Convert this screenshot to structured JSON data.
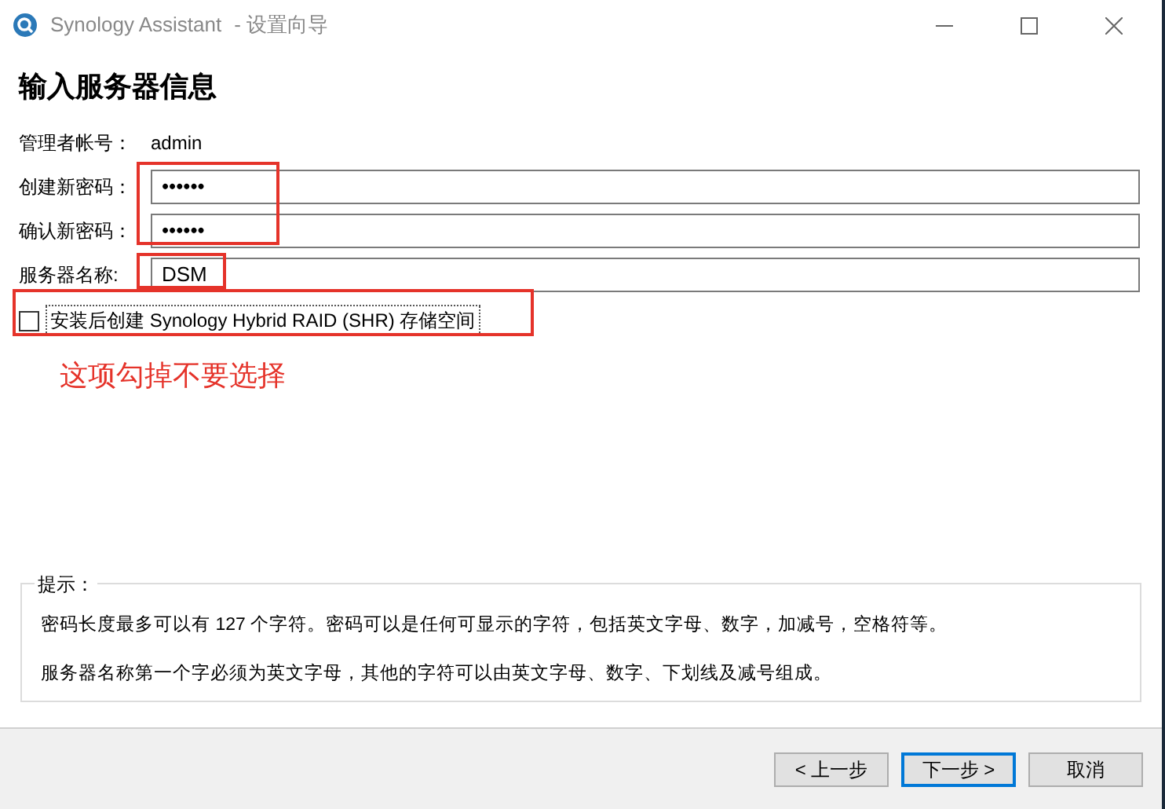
{
  "window": {
    "title": "Synology Assistant",
    "subtitle": "- 设置向导"
  },
  "heading": "输入服务器信息",
  "form": [
    {
      "kind": "static",
      "label": "管理者帐号：",
      "value": "admin"
    },
    {
      "kind": "input",
      "label": "创建新密码：",
      "value": "••••••"
    },
    {
      "kind": "input",
      "label": "确认新密码：",
      "value": "••••••"
    },
    {
      "kind": "input",
      "label": "服务器名称:",
      "value": "DSM"
    }
  ],
  "checkbox": {
    "label": "安装后创建 Synology Hybrid RAID (SHR) 存储空间",
    "checked": false
  },
  "annotation": "这项勾掉不要选择",
  "hints": {
    "title": "提示：",
    "lines": [
      "密码长度最多可以有 127 个字符。密码可以是任何可显示的字符，包括英文字母、数字，加减号，空格符等。",
      "服务器名称第一个字必须为英文字母，其他的字符可以由英文字母、数字、下划线及减号组成。"
    ]
  },
  "buttons": [
    {
      "label": "< 上一步",
      "selected": false
    },
    {
      "label": "下一步 >",
      "selected": true
    },
    {
      "label": "取消",
      "selected": false
    }
  ]
}
